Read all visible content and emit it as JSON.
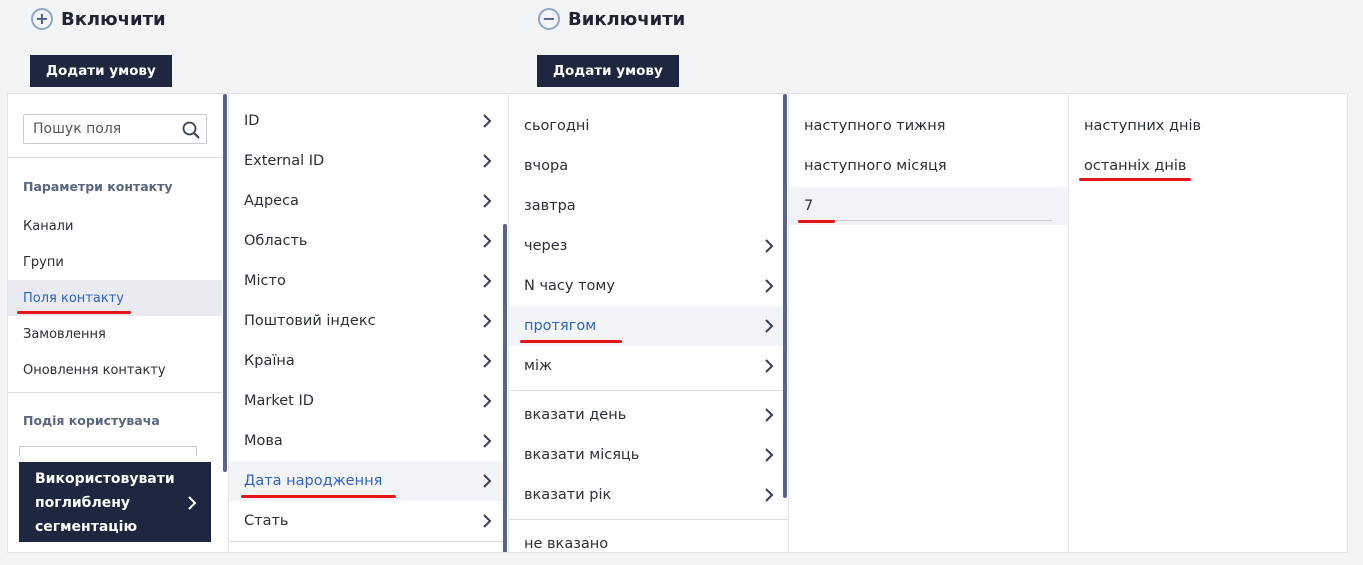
{
  "include": {
    "title": "Включити",
    "icon": "plus-circle-icon",
    "add_label": "Додати умову"
  },
  "exclude": {
    "title": "Виключити",
    "icon": "minus-circle-icon",
    "add_label": "Додати умову"
  },
  "sidebar": {
    "search_placeholder": "Пошук поля",
    "group1_title": "Параметри контакту",
    "items": [
      {
        "label": "Канали"
      },
      {
        "label": "Групи"
      },
      {
        "label": "Поля контакту",
        "active": true
      },
      {
        "label": "Замовлення"
      },
      {
        "label": "Оновлення контакту"
      }
    ],
    "group2_title": "Подія користувача",
    "advanced_button": "Використовувати поглиблену сегментацію"
  },
  "fields": {
    "items": [
      {
        "label": "ID"
      },
      {
        "label": "External ID"
      },
      {
        "label": "Адреса"
      },
      {
        "label": "Область"
      },
      {
        "label": "Місто"
      },
      {
        "label": "Поштовий індекс"
      },
      {
        "label": "Країна"
      },
      {
        "label": "Market ID"
      },
      {
        "label": "Мова"
      },
      {
        "label": "Дата народження",
        "active": true
      },
      {
        "label": "Стать"
      }
    ]
  },
  "conditions": {
    "items": [
      {
        "label": "сьогодні",
        "chevron": false
      },
      {
        "label": "вчора",
        "chevron": false
      },
      {
        "label": "завтра",
        "chevron": false
      },
      {
        "label": "через",
        "chevron": true
      },
      {
        "label": "N часу тому",
        "chevron": true
      },
      {
        "label": "протягом",
        "chevron": true,
        "active": true
      },
      {
        "label": "між",
        "chevron": true
      },
      {
        "label": "вказати день",
        "chevron": true
      },
      {
        "label": "вказати місяць",
        "chevron": true
      },
      {
        "label": "вказати рік",
        "chevron": true
      },
      {
        "label": "не вказано",
        "chevron": false
      }
    ]
  },
  "period": {
    "items": [
      {
        "label": "наступного тижня"
      },
      {
        "label": "наступного місяця"
      }
    ],
    "value": "7"
  },
  "range": {
    "items": [
      {
        "label": "наступних днів"
      },
      {
        "label": "останніх днів",
        "selected": true
      }
    ]
  },
  "colors": {
    "dark_navy": "#1e2640",
    "link_blue": "#2f63c4",
    "highlight_red": "#e4141b",
    "scrollbar": "#5b6485"
  }
}
